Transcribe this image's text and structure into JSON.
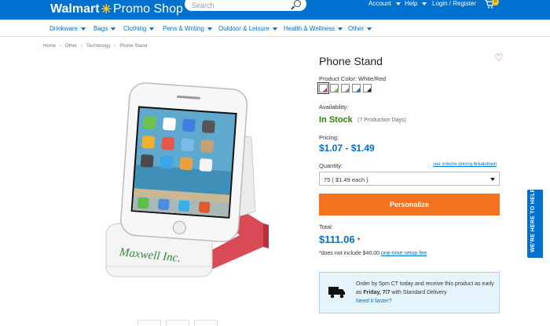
{
  "header": {
    "brand": "Walmart",
    "promo": "Promo Shop",
    "search_placeholder": "Search",
    "account": "Account",
    "help": "Help",
    "login": "Login / Register",
    "cart_count": "0",
    "colors": {
      "brand_blue": "#0071ce",
      "spark_yellow": "#ffc220"
    }
  },
  "categories": [
    "Drinkware",
    "Bags",
    "Clothing",
    "Pens & Writing",
    "Outdoor & Leisure",
    "Health & Wellness",
    "Other"
  ],
  "breadcrumb": [
    "Home",
    "Other",
    "Technology",
    "Phone Stand"
  ],
  "product": {
    "title": "Phone Stand",
    "color_label": "Product Color: White/Red",
    "swatches": [
      "#ffffff/#d94452",
      "#ffffff/#7cc04b",
      "#ffffff/#888888",
      "#ffffff/#2f6eb5",
      "#ffffff/#222222"
    ],
    "availability_label": "Availability:",
    "stock": "In Stock",
    "production_days": "(7 Production Days)",
    "pricing_label": "Pricing:",
    "price_range": "$1.07 - $1.49",
    "quantity_label": "Quantity:",
    "volume_link": "see volume pricing breakdown",
    "quantity_value": "75 ( $1.49 each )",
    "personalize_button": "Personalize",
    "total_label": "Total:",
    "total": "$111.06",
    "total_star": "*",
    "note_prefix": "*does not include $40.00",
    "note_link": "one-time setup fee",
    "imprint_text": "Maxwell Inc."
  },
  "shipping": {
    "line1": "Order by 5pm CT today and receive this product as early as",
    "date": "Friday, 7/7",
    "line2": "with Standard Delivery",
    "link": "Need it faster?"
  },
  "help_tab": "WE'RE HERE TO HELP"
}
